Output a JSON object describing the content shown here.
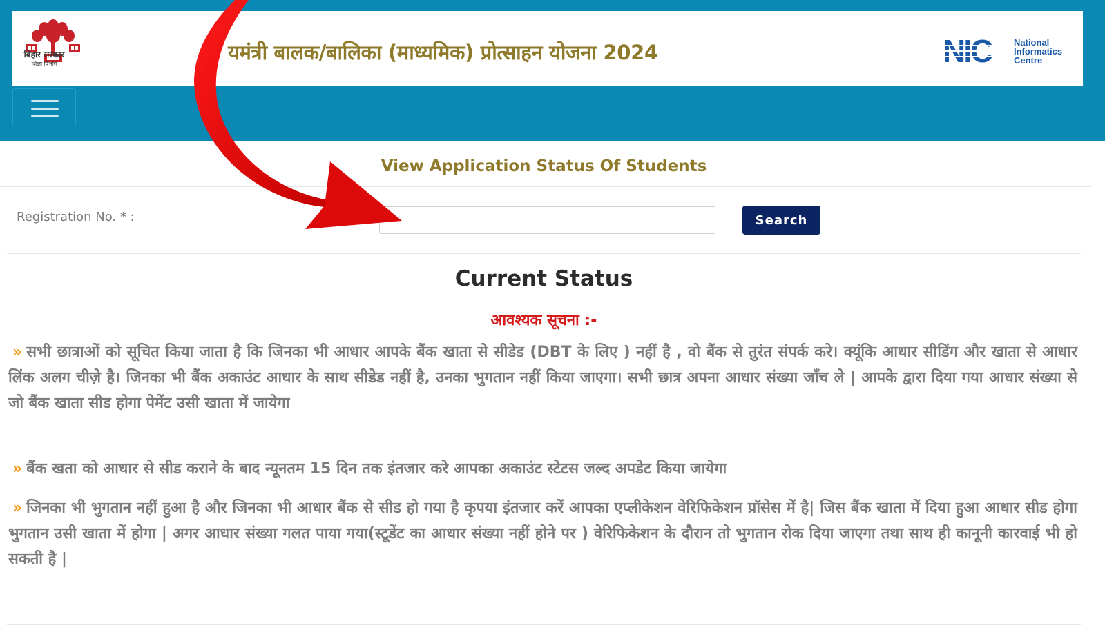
{
  "header": {
    "logo_caption": "बिहार सरकार",
    "logo_subcaption": "शिक्षा विभाग",
    "app_title": "यमंत्री बालक/बालिका (माध्यमिक) प्रोत्साहन योजना 2024",
    "nic_logo_text": "NIC",
    "nic_name_line1": "National",
    "nic_name_line2": "Informatics",
    "nic_name_line3": "Centre"
  },
  "page": {
    "heading": "View Application Status Of Students"
  },
  "search": {
    "label": "Registration No. * :",
    "value": "",
    "placeholder": "",
    "button_label": "Search"
  },
  "status": {
    "title": "Current Status",
    "notice_title": "आवश्यक सूचना :-"
  },
  "notices": [
    "सभी छात्राओं को सूचित किया जाता है कि जिनका भी आधार आपके बैंक खाता से सीडेड (DBT के लिए ) नहीं है , वो बैंक से तुरंत संपर्क करे। क्यूंकि आधार सीडिंग और खाता से आधार लिंक अलग चीज़े है। जिनका भी बैंक अकाउंट आधार के साथ सीडेड नहीं है, उनका भुगतान नहीं किया जाएगा। सभी छात्र अपना आधार संख्या जाँच ले | आपके द्वारा दिया गया आधार संख्या से जो बैंक खाता सीड होगा पेमेंट उसी खाता में जायेगा",
    "बैंक खता को आधार से सीड कराने के बाद न्यूनतम 15 दिन तक इंतजार करे आपका अकाउंट स्टेटस जल्द अपडेट किया जायेगा",
    "जिनका भी भुगतान नहीं हुआ है और जिनका भी आधार बैंक से सीड हो गया है कृपया इंतजार करें आपका एप्लीकेशन वेरिफिकेशन प्रॉसेस में है| जिस बैंक खाता में दिया हुआ आधार सीड होगा भुगतान उसी खाता में होगा | अगर आधार संख्या गलत पाया गया(स्टूडेंट का आधार संख्या नहीं होने पर ) वेरिफिकेशन के दौरान तो भुगतान रोक दिया जाएगा तथा साथ ही कानूनी कारवाई भी हो सकती है |"
  ],
  "icons": {
    "menu": "hamburger-icon",
    "bullet": "double-chevron-right-icon",
    "annotation": "red-arrow"
  },
  "colors": {
    "header_band": "#0989b4",
    "title_gold": "#8e7a2a",
    "search_button": "#0c2462",
    "notice_red": "#d61a1a",
    "bullet_orange": "#f29a1a",
    "arrow_red": "#e60d0d"
  }
}
